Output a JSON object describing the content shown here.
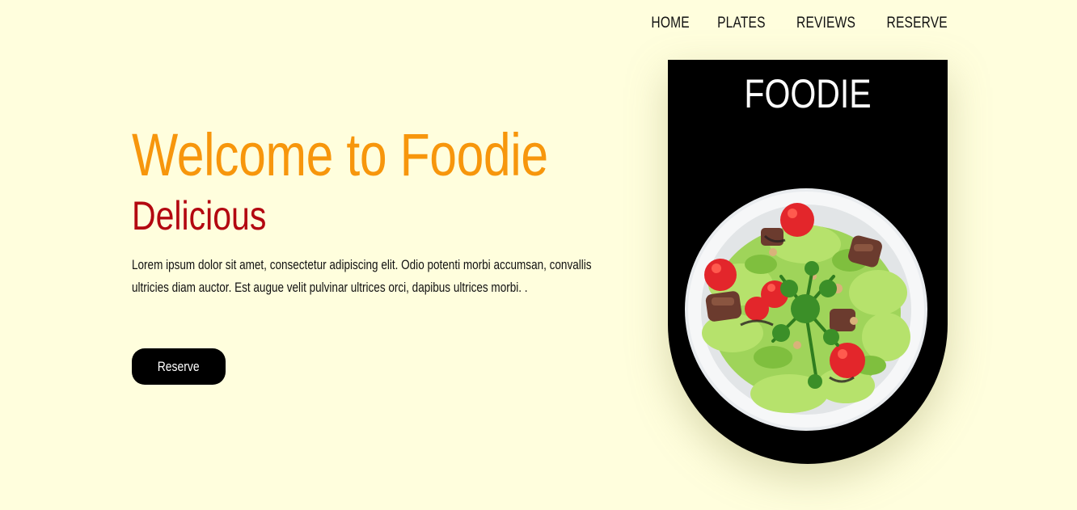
{
  "nav": {
    "items": [
      {
        "label": "HOME"
      },
      {
        "label": "PLATES"
      },
      {
        "label": "REVIEWS"
      },
      {
        "label": "RESERVE"
      }
    ]
  },
  "hero": {
    "title": "Welcome to Foodie",
    "subtitle": "Delicious",
    "text": "Lorem ipsum dolor sit amet, consectetur adipiscing elit. Odio potenti morbi accumsan, convallis ultricies diam auctor. Est augue velit pulvinar ultrices orci, dapibus ultrices morbi. .",
    "button_label": "Reserve"
  },
  "card": {
    "title": "FOODIE",
    "image": "salad-plate-image"
  },
  "colors": {
    "background": "#fffedd",
    "title": "#f7960c",
    "subtitle": "#b30710",
    "card": "#000000",
    "button": "#000000"
  }
}
